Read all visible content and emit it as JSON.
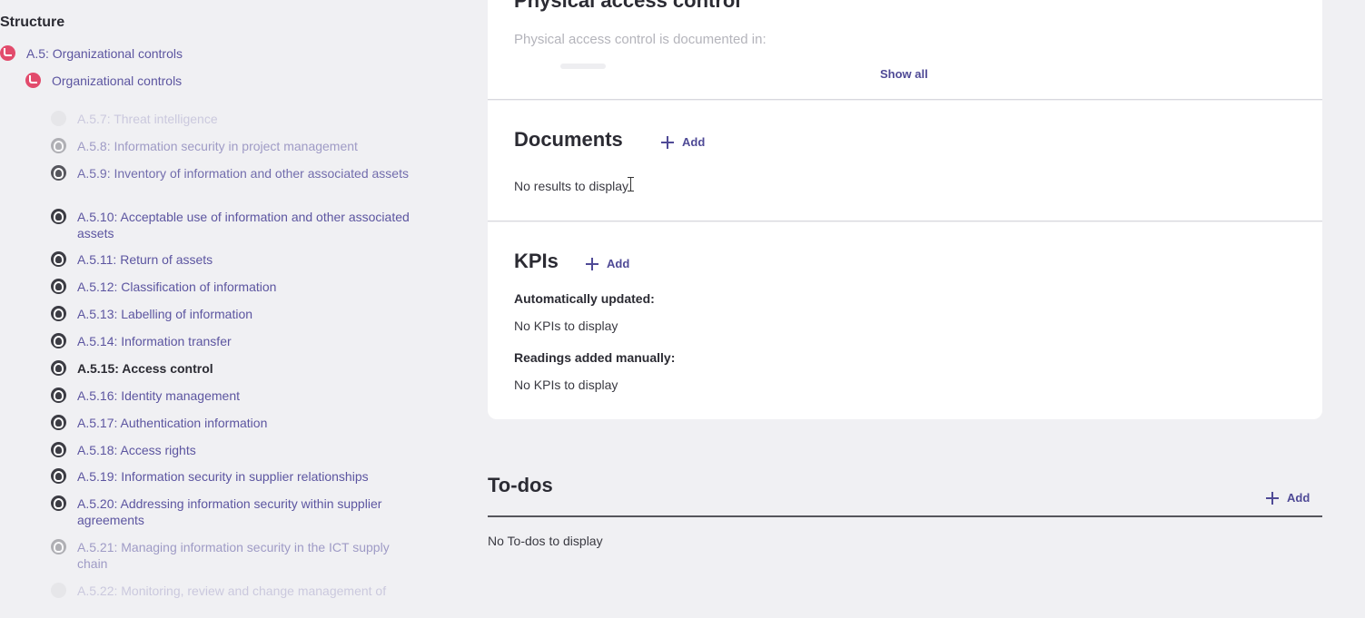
{
  "sidebar": {
    "title": "Structure",
    "items": [
      {
        "label": "A.5: Organizational controls",
        "icon": "red"
      },
      {
        "label": "Organizational controls",
        "icon": "red"
      },
      {
        "label": "A.5.7: Threat intelligence",
        "icon": "faint"
      },
      {
        "label": "A.5.8: Information security in project management",
        "icon": "mid"
      },
      {
        "label": "A.5.9: Inventory of information and other associated assets",
        "icon": "dark"
      },
      {
        "label": "A.5.10: Acceptable use of information and other associated assets",
        "icon": "dark"
      },
      {
        "label": "A.5.11: Return of assets",
        "icon": "dark"
      },
      {
        "label": "A.5.12: Classification of information",
        "icon": "dark"
      },
      {
        "label": "A.5.13: Labelling of information",
        "icon": "dark"
      },
      {
        "label": "A.5.14: Information transfer",
        "icon": "dark"
      },
      {
        "label": "A.5.15: Access control",
        "icon": "dark"
      },
      {
        "label": "A.5.16: Identity management",
        "icon": "dark"
      },
      {
        "label": "A.5.17: Authentication information",
        "icon": "dark"
      },
      {
        "label": "A.5.18: Access rights",
        "icon": "dark"
      },
      {
        "label": "A.5.19: Information security in supplier relationships",
        "icon": "dark"
      },
      {
        "label": "A.5.20: Addressing information security within supplier agreements",
        "icon": "dark"
      },
      {
        "label": "A.5.21: Managing information security in the ICT supply chain",
        "icon": "mid"
      },
      {
        "label": "A.5.22: Monitoring, review and change management of",
        "icon": "faint"
      }
    ]
  },
  "physical_access": {
    "title": "Physical access control",
    "text": "Physical access control is documented in:",
    "show_all": "Show all"
  },
  "documents": {
    "title": "Documents",
    "add_label": "Add",
    "empty": "No results to display"
  },
  "kpis": {
    "title": "KPIs",
    "add_label": "Add",
    "auto_heading": "Automatically updated:",
    "auto_empty": "No KPIs to display",
    "manual_heading": "Readings added manually:",
    "manual_empty": "No KPIs to display"
  },
  "todos": {
    "title": "To-dos",
    "add_label": "Add",
    "empty": "No To-dos to display"
  }
}
